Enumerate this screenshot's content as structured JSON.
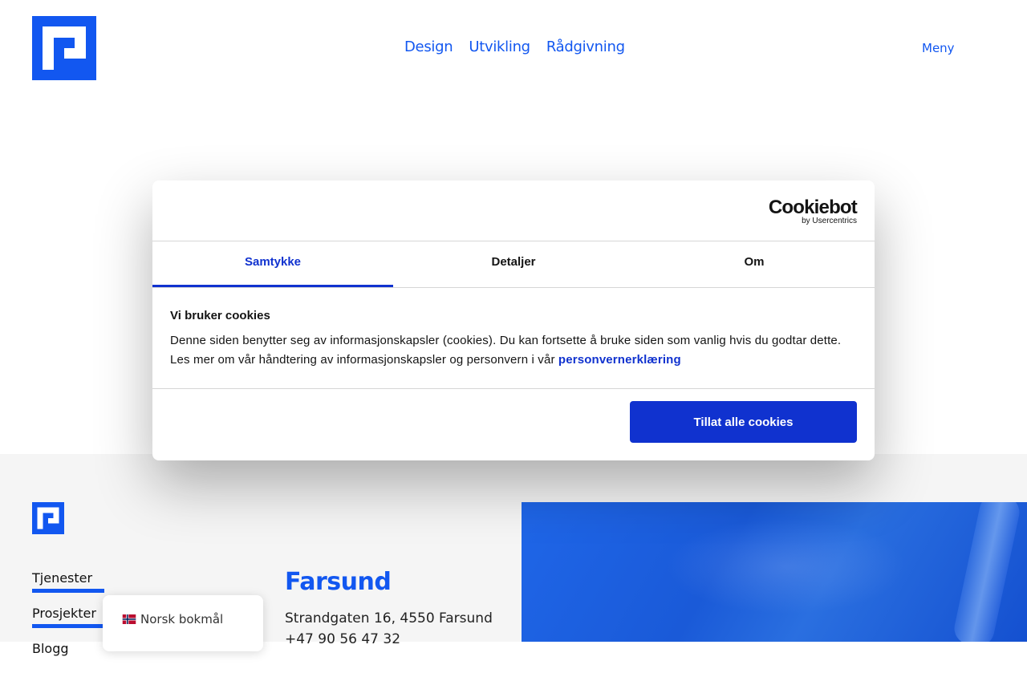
{
  "header": {
    "nav": [
      "Design",
      "Utvikling",
      "Rådgivning"
    ],
    "menu_label": "Meny"
  },
  "cookie": {
    "brand": "Cookiebot",
    "brand_sub": "by Usercentrics",
    "tabs": [
      "Samtykke",
      "Detaljer",
      "Om"
    ],
    "active_tab": "Samtykke",
    "title": "Vi bruker cookies",
    "body": "Denne siden benytter seg av informasjonskapsler (cookies). Du kan fortsette å bruke siden som vanlig hvis du godtar dette. Les mer om vår håndtering av informasjonskapsler og personvern i vår ",
    "link": "personvernerklæring",
    "allow_button": "Tillat alle cookies"
  },
  "footer": {
    "nav": [
      "Tjenester",
      "Prosjekter",
      "Blogg"
    ],
    "office": {
      "city": "Farsund",
      "address": "Strandgaten 16, 4550 Farsund",
      "phone": "+47 90 56 47 32"
    }
  },
  "language": {
    "label": "Norsk bokmål"
  },
  "colors": {
    "brand_blue": "#1257f0",
    "cookie_blue": "#1032cf"
  }
}
